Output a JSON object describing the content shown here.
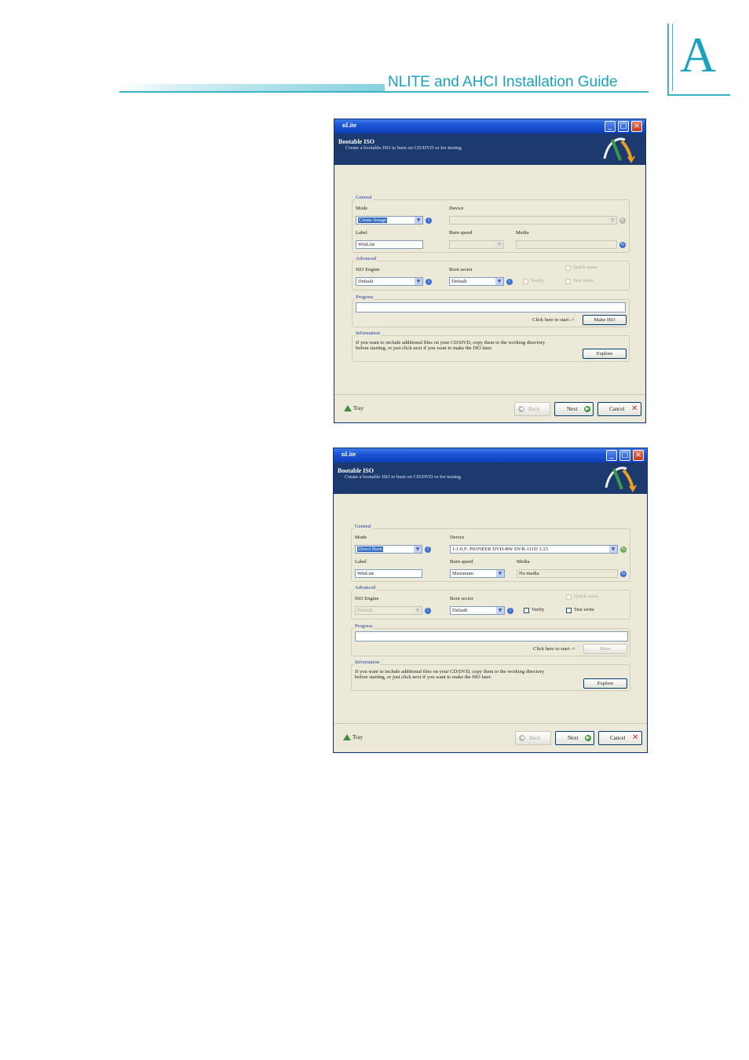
{
  "header": {
    "title": "NLITE and AHCI Installation Guide",
    "tab_letter": "A"
  },
  "windows": [
    {
      "title": "nLite",
      "banner_title": "Bootable ISO",
      "banner_subtitle": "Create a bootable ISO to burn on CD/DVD or for testing.",
      "general_label": "General",
      "mode_label": "Mode",
      "mode_value": "Create Image",
      "device_label": "Device",
      "device_value": "",
      "label_label": "Label",
      "label_value": "WinLite",
      "burn_speed_label": "Burn speed",
      "burn_speed_value": "",
      "media_label": "Media",
      "media_value": "",
      "advanced_label": "Advanced",
      "iso_engine_label": "ISO Engine",
      "iso_engine_value": "Default",
      "boot_sector_label": "Boot sector",
      "boot_sector_value": "Default",
      "quick_erase_label": "Quick erase",
      "verify_label": "Verify",
      "test_write_label": "Test write",
      "progress_label": "Progress",
      "click_here_label": "Click here to start ->",
      "action_button": "Make ISO",
      "information_label": "Information",
      "info_line1": "If you want to include additional files on your CD/DVD, copy them to the working directory",
      "info_line2": "before starting, or just click next if you want to make the ISO later.",
      "explore_button": "Explore",
      "tray_label": "Tray",
      "back_button": "Back",
      "next_button": "Next",
      "cancel_button": "Cancel"
    },
    {
      "title": "nLite",
      "banner_title": "Bootable ISO",
      "banner_subtitle": "Create a bootable ISO to burn on CD/DVD or for testing.",
      "general_label": "General",
      "mode_label": "Mode",
      "mode_value": "Direct Burn",
      "device_label": "Device",
      "device_value": "1:1:0,F: PIONEER DVD-RW DVR-111D 1.23",
      "label_label": "Label",
      "label_value": "WinLite",
      "burn_speed_label": "Burn speed",
      "burn_speed_value": "Maximum",
      "media_label": "Media",
      "media_value": "No media",
      "advanced_label": "Advanced",
      "iso_engine_label": "ISO Engine",
      "iso_engine_value": "Default",
      "boot_sector_label": "Boot sector",
      "boot_sector_value": "Default",
      "quick_erase_label": "Quick erase",
      "verify_label": "Verify",
      "test_write_label": "Test write",
      "progress_label": "Progress",
      "click_here_label": "Click here to start ->",
      "action_button": "Burn",
      "information_label": "Information",
      "info_line1": "If you want to include additional files on your CD/DVD, copy them to the working directory",
      "info_line2": "before starting, or just click next if you want to make the ISO later.",
      "explore_button": "Explore",
      "tray_label": "Tray",
      "back_button": "Back",
      "next_button": "Next",
      "cancel_button": "Cancel"
    }
  ]
}
